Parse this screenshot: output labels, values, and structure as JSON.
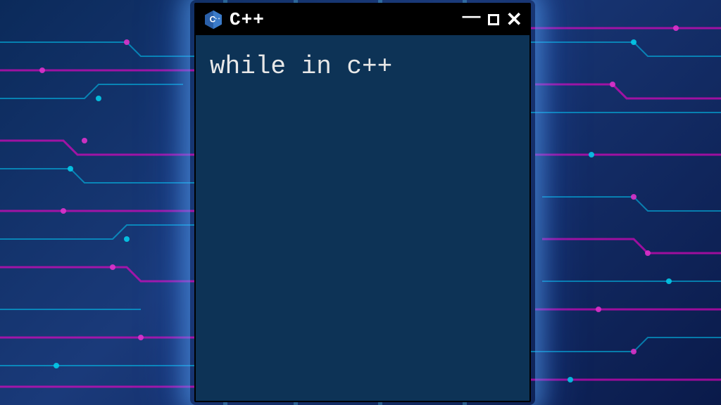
{
  "window": {
    "title": "C++",
    "body_text": "while in c++"
  },
  "icons": {
    "cpp": "cpp-logo-icon",
    "minimize": "minimize-icon",
    "maximize": "maximize-icon",
    "close": "close-icon"
  },
  "colors": {
    "titlebar_bg": "#000000",
    "body_bg": "#0d3356",
    "text": "#e8e8e8",
    "glow": "#4ab0ff"
  }
}
